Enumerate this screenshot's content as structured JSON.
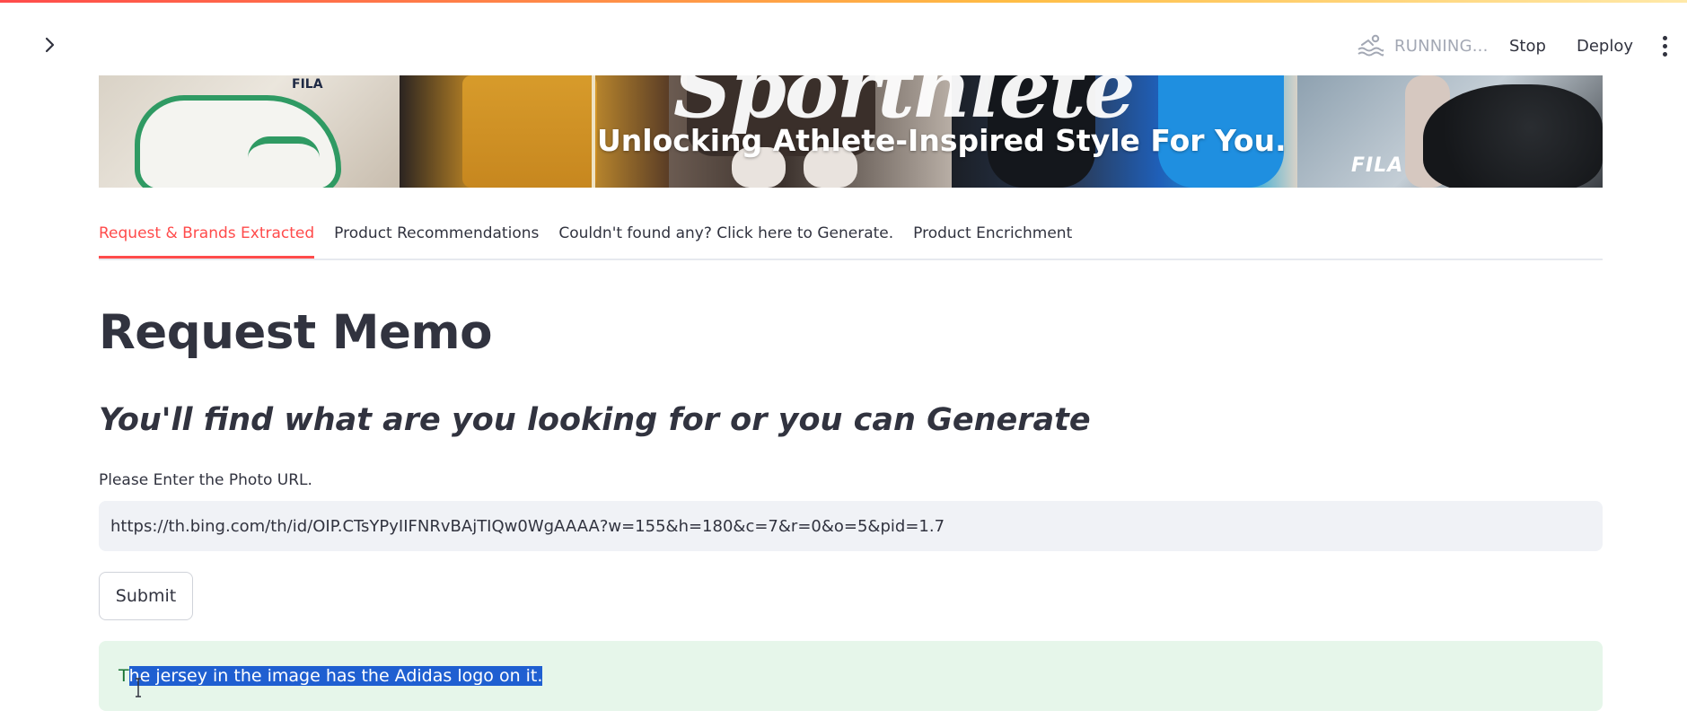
{
  "header": {
    "status_text": "RUNNING...",
    "stop_label": "Stop",
    "deploy_label": "Deploy",
    "icons": {
      "sidebar_toggle": "chevron-right-icon",
      "status": "swimmer-icon",
      "menu": "more-vertical-icon"
    }
  },
  "banner": {
    "script_text": "Sporthlete",
    "tagline": "Unlocking Athlete-Inspired Style For You.",
    "brand_left": "FILA",
    "brand_right": "FILA"
  },
  "tabs": [
    {
      "label": "Request & Brands Extracted",
      "active": true
    },
    {
      "label": "Product Recommendations",
      "active": false
    },
    {
      "label": "Couldn't found any? Click here to Generate.",
      "active": false
    },
    {
      "label": "Product Encrichment",
      "active": false
    }
  ],
  "main": {
    "title": "Request Memo",
    "subtitle": "You'll find what are you looking for or you can Generate",
    "field_label": "Please Enter the Photo URL.",
    "url_value": "https://th.bing.com/th/id/OIP.CTsYPyIIFNRvBAjTIQw0WgAAAA?w=155&h=180&c=7&r=0&o=5&pid=1.7",
    "submit_label": "Submit",
    "result_prefix": "T",
    "result_selected": "he jersey in the image has the Adidas logo on it."
  },
  "colors": {
    "accent": "#ff4b4b",
    "success_bg": "#e6f6ea",
    "success_text": "#177233",
    "selection": "#1f5fd1",
    "input_bg": "#f0f2f6"
  }
}
